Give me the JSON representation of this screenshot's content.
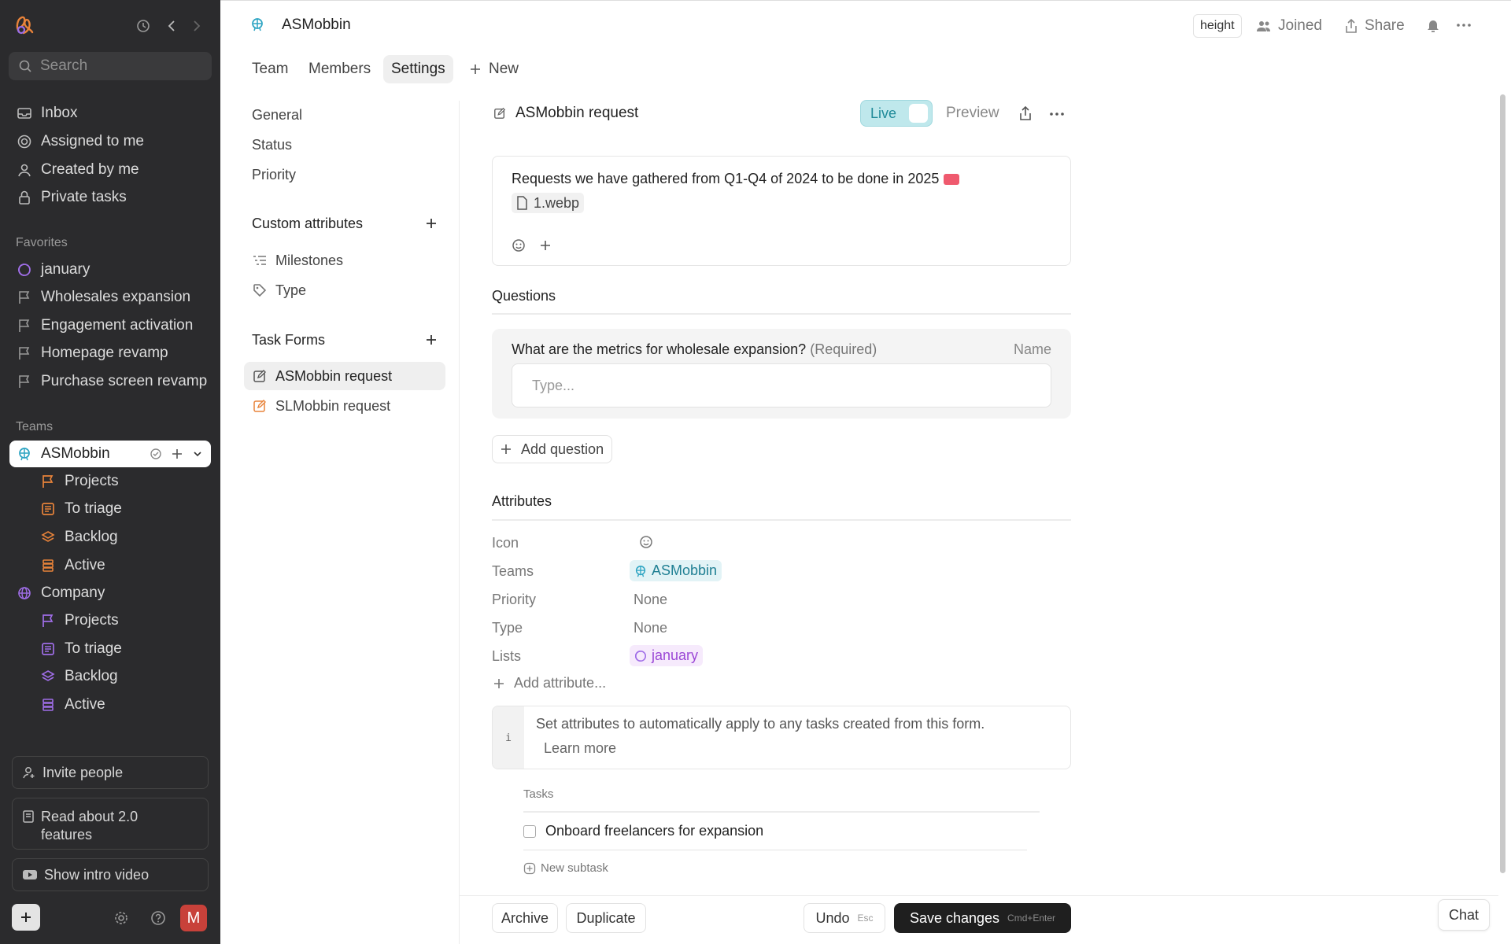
{
  "sidebar": {
    "search_placeholder": "Search",
    "nav": [
      "Inbox",
      "Assigned to me",
      "Created by me",
      "Private tasks"
    ],
    "favorites_heading": "Favorites",
    "favorites": [
      "january",
      "Wholesales expansion",
      "Engagement activation",
      "Homepage revamp",
      "Purchase screen revamp"
    ],
    "teams_heading": "Teams",
    "team1": {
      "name": "ASMobbin",
      "items": [
        "Projects",
        "To triage",
        "Backlog",
        "Active"
      ]
    },
    "team2": {
      "name": "Company",
      "items": [
        "Projects",
        "To triage",
        "Backlog",
        "Active"
      ]
    },
    "invite": "Invite people",
    "read_about": "Read about 2.0 features",
    "intro_video": "Show intro video",
    "avatar_letter": "M"
  },
  "header": {
    "team_name": "ASMobbin",
    "badge": "height",
    "joined": "Joined",
    "share": "Share",
    "tabs": [
      "Team",
      "Members",
      "Settings"
    ],
    "new_label": "New"
  },
  "settings_nav": {
    "general": [
      "General",
      "Status",
      "Priority"
    ],
    "custom_heading": "Custom attributes",
    "custom": [
      "Milestones",
      "Type"
    ],
    "forms_heading": "Task Forms",
    "forms": [
      "ASMobbin request",
      "SLMobbin request"
    ]
  },
  "form": {
    "title": "ASMobbin request",
    "live_label": "Live",
    "preview_label": "Preview",
    "description": "Requests we have gathered from Q1-Q4 of 2024 to be done in 2025",
    "attachment": "1.webp",
    "questions_heading": "Questions",
    "question_text": "What are the metrics for wholesale expansion?",
    "question_required": "(Required)",
    "question_field": "Name",
    "answer_placeholder": "Type...",
    "add_question": "Add question",
    "attributes_heading": "Attributes",
    "attributes": {
      "icon_label": "Icon",
      "teams_label": "Teams",
      "teams_value": "ASMobbin",
      "priority_label": "Priority",
      "priority_value": "None",
      "type_label": "Type",
      "type_value": "None",
      "lists_label": "Lists",
      "lists_value": "january"
    },
    "add_attribute": "Add attribute...",
    "info_text": "Set attributes to automatically apply to any tasks created from this form.",
    "learn_more": "Learn more",
    "info_mark": "i",
    "tasks_heading": "Tasks",
    "task": "Onboard freelancers for expansion",
    "new_subtask": "New subtask"
  },
  "footer": {
    "archive": "Archive",
    "duplicate": "Duplicate",
    "undo": "Undo",
    "undo_key": "Esc",
    "save": "Save changes",
    "save_key": "Cmd+Enter",
    "chat": "Chat"
  },
  "colors": {
    "sidebar_bg": "#2b2b2d",
    "accent_orange": "#e8833a",
    "accent_purple": "#9b6ee8",
    "accent_teal": "#2aa3c2",
    "live_bg": "#bfe8ec",
    "save_bg": "#1f1f1f"
  }
}
